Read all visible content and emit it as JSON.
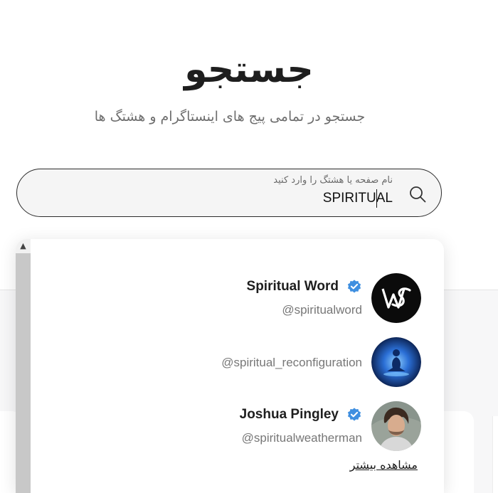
{
  "page": {
    "title": "جستجو",
    "subtitle": "جستجو در تمامی پیج های اینستاگرام و هشتگ ها"
  },
  "search": {
    "label": "نام صفحه یا هشتگ را وارد کنید",
    "value": "SPIRITUAL"
  },
  "results": [
    {
      "name": "Spiritual Word",
      "handle": "@spiritualword",
      "verified": true,
      "avatar_icon": "ws-monogram-logo"
    },
    {
      "name": "",
      "handle": "@spiritual_reconfiguration",
      "verified": false,
      "avatar_icon": "meditation-figure-image"
    },
    {
      "name": "Joshua Pingley",
      "handle": "@spiritualweatherman",
      "verified": true,
      "avatar_icon": "person-photo"
    }
  ],
  "see_more_label": "مشاهده بیشتر",
  "colors": {
    "verified_badge": "#3f8fe0",
    "search_border": "#2b2b2b",
    "search_bg": "#f5f5f5"
  }
}
